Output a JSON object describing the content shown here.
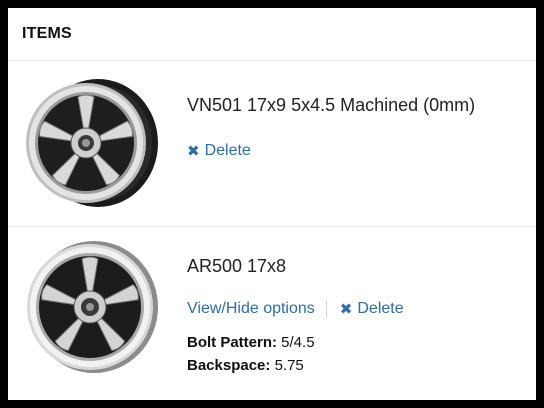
{
  "header": {
    "title": "ITEMS"
  },
  "items": [
    {
      "title": "VN501 17x9 5x4.5 Machined (0mm)",
      "actions": {
        "delete_label": "Delete",
        "delete_icon": "close-x-icon"
      },
      "image": "wheel-photo-black-machined"
    },
    {
      "title": "AR500 17x8",
      "actions": {
        "toggle_options_label": "View/Hide options",
        "delete_label": "Delete",
        "delete_icon": "close-x-icon"
      },
      "specs": [
        {
          "label": "Bolt Pattern:",
          "value": "5/4.5"
        },
        {
          "label": "Backspace:",
          "value": "5.75"
        }
      ],
      "image": "wheel-photo-chrome-lip"
    }
  ],
  "colors": {
    "link": "#2f6da6",
    "background": "#ffffff",
    "frame": "#000000"
  }
}
